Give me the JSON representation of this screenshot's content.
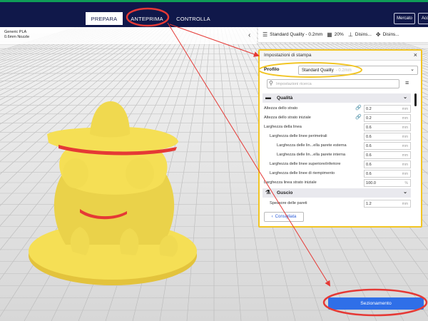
{
  "topbar": {
    "tabs": [
      "PREPARA",
      "ANTEPRIMA",
      "CONTROLLA"
    ],
    "marketplace_label": "Mercato",
    "account_label": "Acc"
  },
  "printer": {
    "material": "Generic PLA",
    "nozzle": "0.6mm Nozzle"
  },
  "print_settings_bar": {
    "profile": "Standard Quality - 0.2mm",
    "infill": "20%",
    "support": "Disins...",
    "adhesion": "Disins..."
  },
  "panel": {
    "title": "Impostazioni di stampa",
    "profile_label": "Profilo",
    "profile_value": "Standard Quality",
    "profile_value_hint": "- 0.2mm",
    "search_placeholder": "Impostazioni ricerca",
    "categories": {
      "quality": "Qualità",
      "walls": "Guscio"
    },
    "rows": [
      {
        "label": "Altezza dello strato",
        "value": "0.2",
        "unit": "mm"
      },
      {
        "label": "Altezza dello strato iniziale",
        "value": "0.2",
        "unit": "mm"
      },
      {
        "label": "Larghezza della linea",
        "value": "0.6",
        "unit": "mm"
      },
      {
        "label": "Larghezza delle linee perimetrali",
        "value": "0.6",
        "unit": "mm"
      },
      {
        "label": "Larghezza delle lin...ella parete esterna",
        "value": "0.6",
        "unit": "mm"
      },
      {
        "label": "Larghezza delle lin...ella parete interna",
        "value": "0.6",
        "unit": "mm"
      },
      {
        "label": "Larghezza delle linee superiore/inferiore",
        "value": "0.6",
        "unit": "mm"
      },
      {
        "label": "Larghezza delle linee di riempimento",
        "value": "0.6",
        "unit": "mm"
      },
      {
        "label": "Larghezza linea strato iniziale",
        "value": "100.0",
        "unit": "%"
      },
      {
        "label": "Spessore delle pareti",
        "value": "1.2",
        "unit": "mm"
      }
    ],
    "recommended_label": "Consigliata"
  },
  "slice_button": "Sezionamento",
  "colors": {
    "topbar": "#10184a",
    "model": "#f5df55",
    "highlight": "#f2c524",
    "annotation": "#e53935",
    "slice_button": "#2f6fe8"
  },
  "icons": {
    "close": "close-icon",
    "search": "search-icon",
    "menu": "menu-icon",
    "link": "link-icon",
    "chevron": "chevron-down-icon",
    "back": "chevron-left-icon"
  }
}
